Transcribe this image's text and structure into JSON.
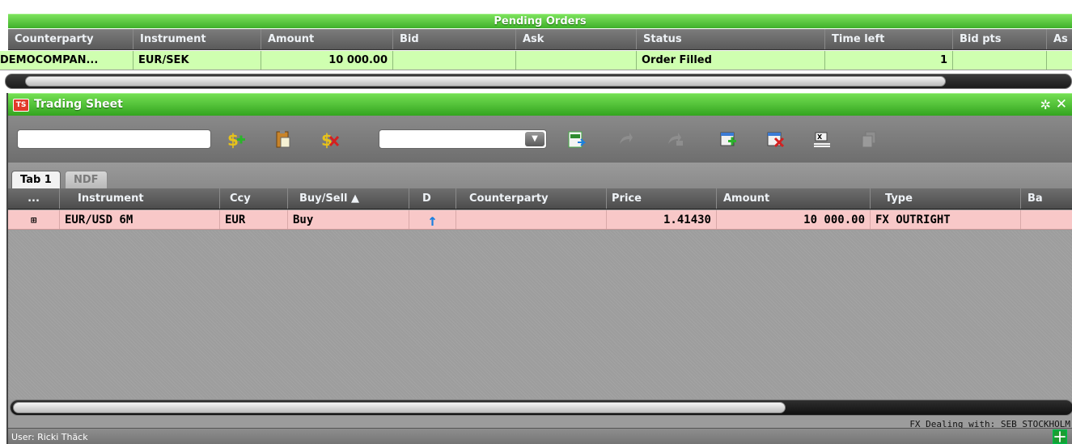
{
  "pending_orders": {
    "title": "Pending Orders",
    "columns": [
      "Counterparty",
      "Instrument",
      "Amount",
      "Bid",
      "Ask",
      "Status",
      "Time left",
      "Bid pts",
      "As"
    ],
    "rows": [
      [
        "DEMOCOMPAN...",
        "EUR/SEK",
        "10 000.00",
        "",
        "",
        "Order Filled",
        "1",
        "",
        ""
      ]
    ]
  },
  "trading_sheet": {
    "logo_text": "TS",
    "title": "Trading Sheet",
    "search_value": "",
    "combo_value": "",
    "tabs": [
      "Tab 1",
      "NDF"
    ],
    "columns": [
      "...",
      "Instrument",
      "Ccy",
      "Buy/Sell ▲",
      "D",
      "Counterparty",
      "Price",
      "Amount",
      "Type",
      "Ba"
    ],
    "rows": [
      [
        "⊞",
        "EUR/USD 6M",
        "EUR",
        "Buy",
        "↑",
        "",
        "1.41430",
        "10 000.00",
        "FX OUTRIGHT",
        ""
      ]
    ],
    "dealing_text": "FX Dealing with: SEB STOCKHOLM",
    "user_text": "User: Ricki Thäck"
  },
  "colors": {
    "title_green": "#3fb02a",
    "pending_row": "#cfffb0",
    "trade_row": "#f8c8c8",
    "direction_arrow": "#1a7fe0"
  },
  "icons": [
    "add-currency-icon",
    "clipboard-icon",
    "remove-currency-icon",
    "export-excel-icon",
    "undo-icon",
    "redo-icon",
    "add-row-icon",
    "delete-row-icon",
    "settings-list-icon",
    "copy-icon"
  ]
}
